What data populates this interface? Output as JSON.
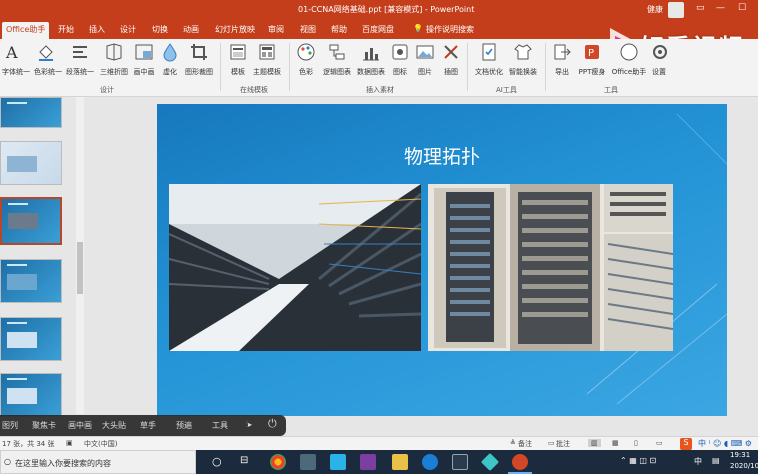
{
  "window": {
    "title": "01-CCNA网络基础.ppt [兼容模式] - PowerPoint",
    "user": "健康"
  },
  "tabs": [
    "Office助手",
    "开始",
    "插入",
    "设计",
    "切换",
    "动画",
    "幻灯片放映",
    "审阅",
    "视图",
    "帮助",
    "百度网盘",
    "操作说明搜索"
  ],
  "ribbon": {
    "buttons": [
      {
        "label": "字体统一",
        "icon": "font-icon"
      },
      {
        "label": "色彩统一",
        "icon": "fill-icon"
      },
      {
        "label": "段落统一",
        "icon": "paragraph-icon"
      },
      {
        "label": "三维折图",
        "icon": "fold-icon"
      },
      {
        "label": "画中画",
        "icon": "pip-icon"
      },
      {
        "label": "虚化",
        "icon": "blur-icon"
      },
      {
        "label": "图形裁图",
        "icon": "crop-icon"
      },
      {
        "label": "模板",
        "icon": "template-icon"
      },
      {
        "label": "主题模板",
        "icon": "theme-icon"
      },
      {
        "label": "色彩",
        "icon": "palette-icon"
      },
      {
        "label": "逻辑图表",
        "icon": "logic-chart-icon"
      },
      {
        "label": "数据图表",
        "icon": "data-chart-icon"
      },
      {
        "label": "图标",
        "icon": "icon-icon"
      },
      {
        "label": "图片",
        "icon": "picture-icon"
      },
      {
        "label": "插图",
        "icon": "illustration-icon"
      },
      {
        "label": "文档优化",
        "icon": "doc-optimize-icon"
      },
      {
        "label": "智能换装",
        "icon": "smart-dress-icon"
      },
      {
        "label": "导出",
        "icon": "export-icon"
      },
      {
        "label": "PPT瘦身",
        "icon": "slim-icon"
      },
      {
        "label": "Office助手",
        "icon": "assistant-icon"
      },
      {
        "label": "设置",
        "icon": "settings-icon"
      }
    ],
    "groups": [
      "设计",
      "在线模板",
      "插入素材",
      "AI工具",
      "工具"
    ]
  },
  "watermark": "好看视频",
  "slide": {
    "title": "物理拓扑"
  },
  "float_toolbar": [
    "图列",
    "聚焦卡",
    "画中画",
    "大头贴",
    "草手",
    "预遍",
    "工具"
  ],
  "statusbar": {
    "slide_count": "17 张，共 34 张",
    "language": "中文(中国)",
    "notes": "备注",
    "comments": "批注"
  },
  "taskbar": {
    "search_placeholder": "在这里输入你要搜索的内容",
    "time": "19:31",
    "date": "2020/10",
    "ime": "中"
  },
  "colors": {
    "accent": "#c43e1c",
    "slide_bg": "#1f8ccf",
    "taskbar": "#1c2a3d"
  }
}
